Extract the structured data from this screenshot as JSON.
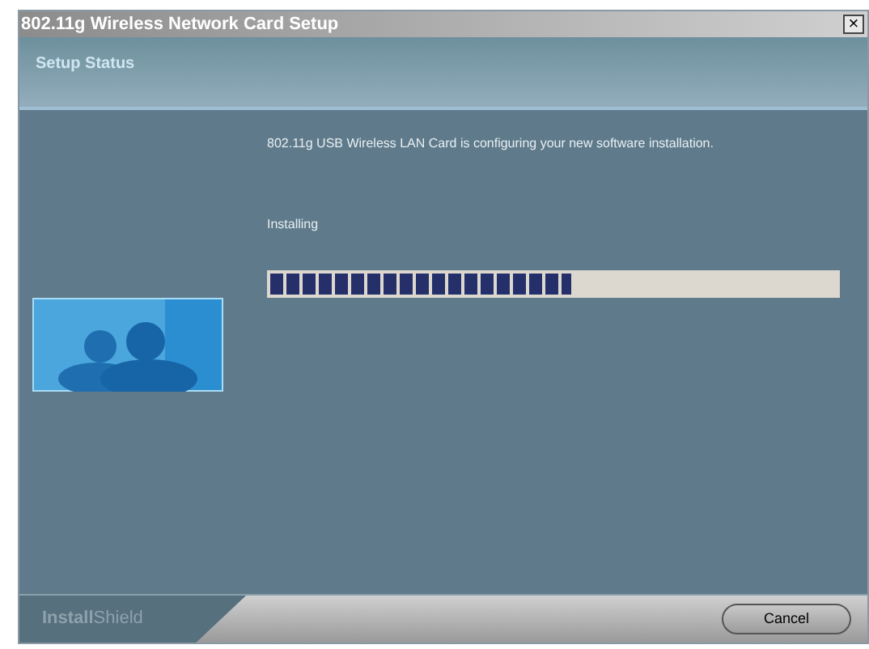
{
  "window": {
    "title": "802.11g Wireless Network Card Setup",
    "close": "×"
  },
  "header": {
    "title": "Setup Status"
  },
  "body": {
    "message": "802.11g USB Wireless LAN Card is configuring your new software installation.",
    "status": "Installing",
    "progress": {
      "level": 0.53
    }
  },
  "footer": {
    "brand": "**Install**Shield",
    "buttons": [
      {
        "label": "Cancel",
        "disabled": false
      }
    ]
  }
}
